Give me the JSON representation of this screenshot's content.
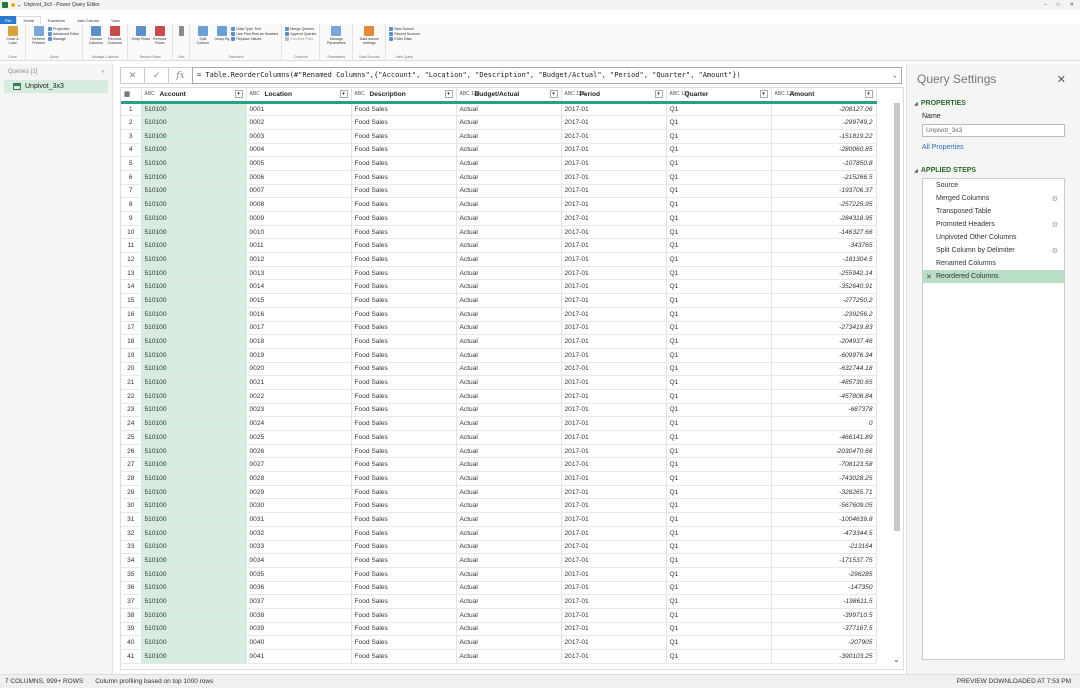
{
  "window": {
    "title": "Unpivot_3x3 - Power Query Editor",
    "controls": [
      "–",
      "□",
      "✕"
    ]
  },
  "ribbon": {
    "tabs": [
      "File",
      "Home",
      "Transform",
      "Add Column",
      "View"
    ],
    "active_tab": "Home",
    "groups": [
      {
        "label": "Close",
        "buttons": [
          "Close & Load"
        ]
      },
      {
        "label": "Query",
        "buttons": [
          "Refresh Preview"
        ],
        "small": [
          "Properties",
          "Advanced Editor",
          "Manage"
        ]
      },
      {
        "label": "Manage Columns",
        "buttons": [
          "Choose Columns",
          "Remove Columns"
        ]
      },
      {
        "label": "Reduce Rows",
        "buttons": [
          "Keep Rows",
          "Remove Rows"
        ]
      },
      {
        "label": "Sort",
        "buttons": [
          ""
        ]
      },
      {
        "label": "Transform",
        "buttons": [
          "Split Column",
          "Group By"
        ],
        "small": [
          "Data Type: Text",
          "Use First Row as Headers",
          "Replace Values"
        ]
      },
      {
        "label": "Combine",
        "small": [
          "Merge Queries",
          "Append Queries",
          "Combine Files"
        ]
      },
      {
        "label": "Parameters",
        "buttons": [
          "Manage Parameters"
        ]
      },
      {
        "label": "Data Sources",
        "buttons": [
          "Data source settings"
        ]
      },
      {
        "label": "New Query",
        "small": [
          "New Source",
          "Recent Sources",
          "Enter Data"
        ]
      }
    ]
  },
  "queries": {
    "header": "Queries [1]",
    "items": [
      "Unpivot_3x3"
    ]
  },
  "formula": {
    "text": "= Table.ReorderColumns(#\"Renamed Columns\",{\"Account\", \"Location\", \"Description\", \"Budget/Actual\", \"Period\", \"Quarter\", \"Amount\"})"
  },
  "grid": {
    "columns": [
      {
        "name": "Account",
        "type": "ABC"
      },
      {
        "name": "Location",
        "type": "ABC"
      },
      {
        "name": "Description",
        "type": "ABC"
      },
      {
        "name": "Budget/Actual",
        "type": "ABC 123"
      },
      {
        "name": "Period",
        "type": "ABC 123"
      },
      {
        "name": "Quarter",
        "type": "ABC 123"
      },
      {
        "name": "Amount",
        "type": "ABC 123"
      }
    ],
    "rows": [
      [
        "510100",
        "0001",
        "Food Sales",
        "Actual",
        "2017-01",
        "Q1",
        "-208127.06"
      ],
      [
        "510100",
        "0002",
        "Food Sales",
        "Actual",
        "2017-01",
        "Q1",
        "-299749.2"
      ],
      [
        "510100",
        "0003",
        "Food Sales",
        "Actual",
        "2017-01",
        "Q1",
        "-151819.22"
      ],
      [
        "510100",
        "0004",
        "Food Sales",
        "Actual",
        "2017-01",
        "Q1",
        "-280060.85"
      ],
      [
        "510100",
        "0005",
        "Food Sales",
        "Actual",
        "2017-01",
        "Q1",
        "-107850.8"
      ],
      [
        "510100",
        "0006",
        "Food Sales",
        "Actual",
        "2017-01",
        "Q1",
        "-215266.5"
      ],
      [
        "510100",
        "0007",
        "Food Sales",
        "Actual",
        "2017-01",
        "Q1",
        "-193706.37"
      ],
      [
        "510100",
        "0008",
        "Food Sales",
        "Actual",
        "2017-01",
        "Q1",
        "-257225.95"
      ],
      [
        "510100",
        "0009",
        "Food Sales",
        "Actual",
        "2017-01",
        "Q1",
        "-284318.95"
      ],
      [
        "510100",
        "0010",
        "Food Sales",
        "Actual",
        "2017-01",
        "Q1",
        "-146327.66"
      ],
      [
        "510100",
        "0011",
        "Food Sales",
        "Actual",
        "2017-01",
        "Q1",
        "-343765"
      ],
      [
        "510100",
        "0012",
        "Food Sales",
        "Actual",
        "2017-01",
        "Q1",
        "-181304.5"
      ],
      [
        "510100",
        "0013",
        "Food Sales",
        "Actual",
        "2017-01",
        "Q1",
        "-255942.14"
      ],
      [
        "510100",
        "0014",
        "Food Sales",
        "Actual",
        "2017-01",
        "Q1",
        "-352640.91"
      ],
      [
        "510100",
        "0015",
        "Food Sales",
        "Actual",
        "2017-01",
        "Q1",
        "-277250.2"
      ],
      [
        "510100",
        "0016",
        "Food Sales",
        "Actual",
        "2017-01",
        "Q1",
        "-239256.2"
      ],
      [
        "510100",
        "0017",
        "Food Sales",
        "Actual",
        "2017-01",
        "Q1",
        "-273419.83"
      ],
      [
        "510100",
        "0018",
        "Food Sales",
        "Actual",
        "2017-01",
        "Q1",
        "-204937.46"
      ],
      [
        "510100",
        "0019",
        "Food Sales",
        "Actual",
        "2017-01",
        "Q1",
        "-609976.34"
      ],
      [
        "510100",
        "0020",
        "Food Sales",
        "Actual",
        "2017-01",
        "Q1",
        "-632744.18"
      ],
      [
        "510100",
        "0021",
        "Food Sales",
        "Actual",
        "2017-01",
        "Q1",
        "-485730.65"
      ],
      [
        "510100",
        "0022",
        "Food Sales",
        "Actual",
        "2017-01",
        "Q1",
        "-457808.84"
      ],
      [
        "510100",
        "0023",
        "Food Sales",
        "Actual",
        "2017-01",
        "Q1",
        "-687378"
      ],
      [
        "510100",
        "0024",
        "Food Sales",
        "Actual",
        "2017-01",
        "Q1",
        "0"
      ],
      [
        "510100",
        "0025",
        "Food Sales",
        "Actual",
        "2017-01",
        "Q1",
        "-466141.89"
      ],
      [
        "510100",
        "0026",
        "Food Sales",
        "Actual",
        "2017-01",
        "Q1",
        "-2030470.66"
      ],
      [
        "510100",
        "0027",
        "Food Sales",
        "Actual",
        "2017-01",
        "Q1",
        "-708123.58"
      ],
      [
        "510100",
        "0028",
        "Food Sales",
        "Actual",
        "2017-01",
        "Q1",
        "-743028.25"
      ],
      [
        "510100",
        "0029",
        "Food Sales",
        "Actual",
        "2017-01",
        "Q1",
        "-328265.71"
      ],
      [
        "510100",
        "0030",
        "Food Sales",
        "Actual",
        "2017-01",
        "Q1",
        "-567609.05"
      ],
      [
        "510100",
        "0031",
        "Food Sales",
        "Actual",
        "2017-01",
        "Q1",
        "-1004639.8"
      ],
      [
        "510100",
        "0032",
        "Food Sales",
        "Actual",
        "2017-01",
        "Q1",
        "-473344.5"
      ],
      [
        "510100",
        "0033",
        "Food Sales",
        "Actual",
        "2017-01",
        "Q1",
        "-213164"
      ],
      [
        "510100",
        "0034",
        "Food Sales",
        "Actual",
        "2017-01",
        "Q1",
        "-171537.75"
      ],
      [
        "510100",
        "0035",
        "Food Sales",
        "Actual",
        "2017-01",
        "Q1",
        "-296285"
      ],
      [
        "510100",
        "0036",
        "Food Sales",
        "Actual",
        "2017-01",
        "Q1",
        "-147350"
      ],
      [
        "510100",
        "0037",
        "Food Sales",
        "Actual",
        "2017-01",
        "Q1",
        "-198611.5"
      ],
      [
        "510100",
        "0038",
        "Food Sales",
        "Actual",
        "2017-01",
        "Q1",
        "-399710.5"
      ],
      [
        "510100",
        "0039",
        "Food Sales",
        "Actual",
        "2017-01",
        "Q1",
        "-377167.5"
      ],
      [
        "510100",
        "0040",
        "Food Sales",
        "Actual",
        "2017-01",
        "Q1",
        "-207905"
      ],
      [
        "510100",
        "0041",
        "Food Sales",
        "Actual",
        "2017-01",
        "Q1",
        "-390103.25"
      ]
    ]
  },
  "settings": {
    "title": "Query Settings",
    "properties_header": "PROPERTIES",
    "name_label": "Name",
    "name_value": "Unpivot_3x3",
    "all_properties": "All Properties",
    "steps_header": "APPLIED STEPS",
    "steps": [
      {
        "label": "Source",
        "gear": false
      },
      {
        "label": "Merged Columns",
        "gear": true
      },
      {
        "label": "Transposed Table",
        "gear": false
      },
      {
        "label": "Promoted Headers",
        "gear": true
      },
      {
        "label": "Unpivoted Other Columns",
        "gear": false
      },
      {
        "label": "Split Column by Delimiter",
        "gear": true
      },
      {
        "label": "Renamed Columns",
        "gear": false
      },
      {
        "label": "Reordered Columns",
        "gear": false,
        "active": true
      }
    ]
  },
  "status": {
    "left": "7 COLUMNS, 999+ ROWS",
    "profiling": "Column profiling based on top 1000 rows",
    "right": "PREVIEW DOWNLOADED AT 7:53 PM"
  },
  "colors": {
    "accent": "#27a085",
    "selected_column": "#d6ecdf",
    "active_step": "#b9e0c6",
    "file_tab": "#2b7ad0"
  }
}
